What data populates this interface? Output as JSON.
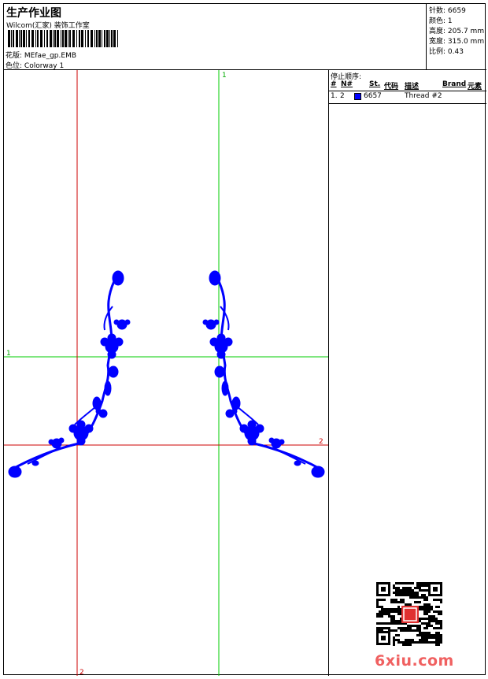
{
  "header": {
    "title": "生产作业图",
    "studio": "Wilcom(汇家) 装饰工作室",
    "design_label": "花版:",
    "design_value": "MEfae_gp.EMB",
    "colorway_label": "色位:",
    "colorway_value": "Colorway 1"
  },
  "stats": {
    "stitches_label": "针数:",
    "stitches_value": "6659",
    "colors_label": "颜色:",
    "colors_value": "1",
    "height_label": "高度:",
    "height_value": "205.7 mm",
    "width_label": "宽度:",
    "width_value": "315.0 mm",
    "scale_label": "比例:",
    "scale_value": "0.43"
  },
  "guides": {
    "top_green": "1",
    "left_green": "1",
    "right_red": "2",
    "bottom_red": "2"
  },
  "stop_sequence": {
    "title": "停止顺序:",
    "columns": {
      "hash": "#",
      "n": "N#",
      "st": "St.",
      "code": "代码",
      "desc": "描述",
      "brand": "Brand",
      "element": "元素"
    },
    "rows": [
      {
        "index": "1.",
        "n": "2",
        "code": "6657",
        "desc": "Thread #2",
        "color": "#0000ff"
      }
    ]
  },
  "colors": {
    "design": "#0000ff",
    "guide_green": "#00cc00",
    "guide_red": "#cc0000",
    "watermark": "#f06060"
  },
  "watermark": {
    "text": "6xiu.com"
  }
}
